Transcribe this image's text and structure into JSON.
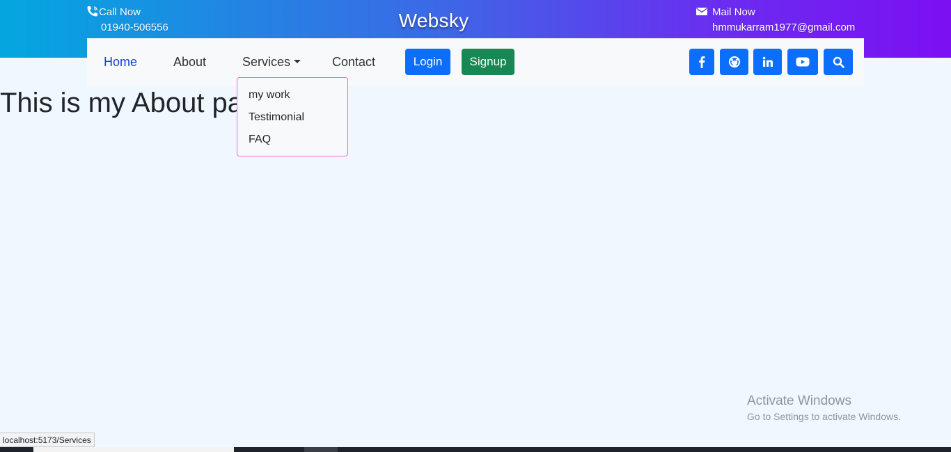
{
  "topbar": {
    "call": {
      "label": "Call Now",
      "number": "01940-506556",
      "icon": "phone-icon"
    },
    "brand": "Websky",
    "mail": {
      "label": "Mail Now",
      "address": "hmmukarram1977@gmail.com",
      "icon": "envelope-icon"
    },
    "gradient": [
      "#03a7e0",
      "#3b6ae6",
      "#6a2ef0",
      "#7c0ff3"
    ]
  },
  "nav": {
    "links": [
      "Home",
      "About",
      "Services",
      "Contact"
    ],
    "active": "Home",
    "login_label": "Login",
    "signup_label": "Signup",
    "social_icons": [
      "facebook-icon",
      "github-icon",
      "linkedin-icon",
      "youtube-icon",
      "search-icon"
    ]
  },
  "dropdown": {
    "items": [
      "my work",
      "Testimonial",
      "FAQ"
    ],
    "border_color": "#e66ce0"
  },
  "main": {
    "heading": "This is my About page"
  },
  "watermark": {
    "title": "Activate Windows",
    "subtitle": "Go to Settings to activate Windows."
  },
  "status_bar": {
    "url": "localhost:5173/Services"
  },
  "colors": {
    "primary": "#0d6efd",
    "success": "#198754",
    "active_link": "#1a3fd8",
    "page_bg": "#f0f8ff"
  }
}
